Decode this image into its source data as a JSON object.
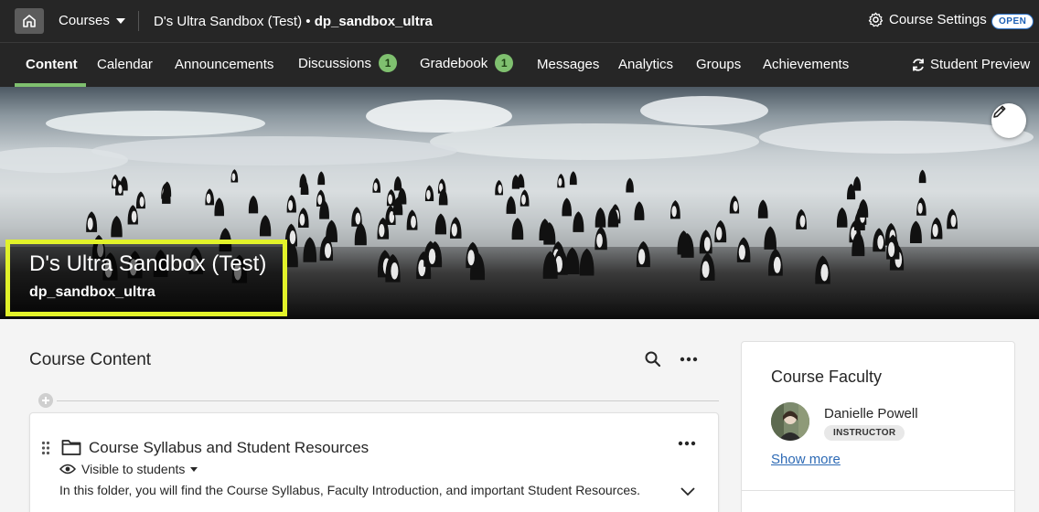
{
  "topbar": {
    "courses_label": "Courses",
    "breadcrumb_title": "D's Ultra Sandbox (Test)",
    "breadcrumb_separator": " • ",
    "breadcrumb_code": "dp_sandbox_ultra",
    "course_settings_label": "Course Settings",
    "status_badge": "OPEN"
  },
  "nav": {
    "tabs": [
      {
        "label": "Content",
        "active": true
      },
      {
        "label": "Calendar"
      },
      {
        "label": "Announcements"
      },
      {
        "label": "Discussions",
        "badge": "1"
      },
      {
        "label": "Gradebook",
        "badge": "1"
      },
      {
        "label": "Messages"
      },
      {
        "label": "Analytics"
      },
      {
        "label": "Groups"
      },
      {
        "label": "Achievements"
      }
    ],
    "student_preview_label": "Student Preview"
  },
  "banner": {
    "title": "D's Ultra Sandbox (Test)",
    "code": "dp_sandbox_ultra",
    "highlight_color": "#e2f22a"
  },
  "course_content": {
    "title": "Course Content",
    "items": [
      {
        "title": "Course Syllabus and Student Resources",
        "icon": "folder-icon",
        "visibility": "Visible to students",
        "description": "In this folder, you will find the Course Syllabus, Faculty Introduction, and important Student Resources."
      }
    ]
  },
  "faculty": {
    "title": "Course Faculty",
    "members": [
      {
        "name": "Danielle Powell",
        "role": "INSTRUCTOR"
      }
    ],
    "show_more_label": "Show more"
  },
  "colors": {
    "topbar_bg": "#262626",
    "accent_green": "#7fc06f",
    "link_blue": "#2d6ab5"
  }
}
